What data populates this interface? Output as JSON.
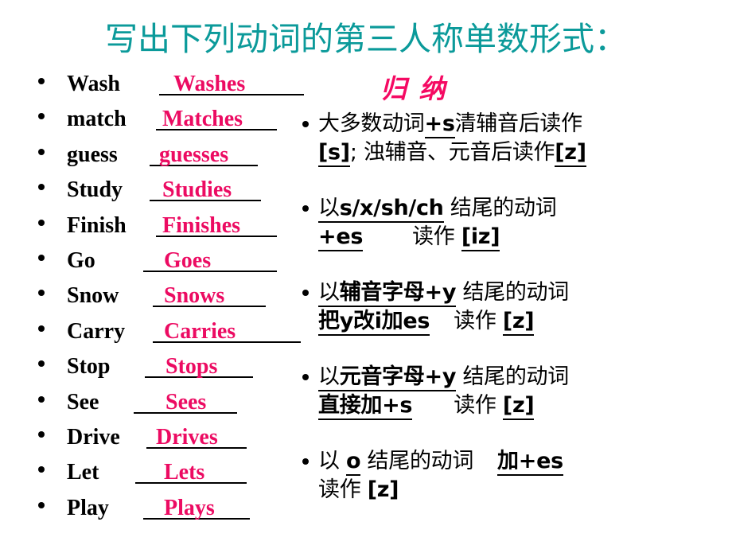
{
  "slide": {
    "title": "写出下列动词的第三人称单数形式：",
    "title_color": "#0b9a9a",
    "answer_color": "#ec0b62",
    "background": "#ffffff"
  },
  "left_column": {
    "rows": [
      {
        "verb": "Wash",
        "answer": "Washes"
      },
      {
        "verb": "match",
        "answer": "Matches"
      },
      {
        "verb": " guess",
        "answer": "guesses"
      },
      {
        "verb": "Study",
        "answer": "Studies"
      },
      {
        "verb": "Finish",
        "answer": "Finishes"
      },
      {
        "verb": "Go",
        "answer": "Goes"
      },
      {
        "verb": "Snow",
        "answer": "Snows"
      },
      {
        "verb": "Carry",
        "answer": "Carries"
      },
      {
        "verb": "Stop",
        "answer": "Stops"
      },
      {
        "verb": "See",
        "answer": "Sees"
      },
      {
        "verb": "Drive",
        "answer": "Drives"
      },
      {
        "verb": "Let",
        "answer": "Lets"
      },
      {
        "verb": "Play",
        "answer": "Plays"
      }
    ]
  },
  "right_column": {
    "heading": "归  纳",
    "heading_color": "#f50a63",
    "rules": [
      {
        "line1_a": "大多数动词",
        "line1_underlined": "+s",
        "line1_b": "清辅音后读作",
        "line2_a": "[s]",
        "line2_b": "; 浊辅音、元音后读作",
        "line2_c": "[z]",
        "full": "大多数动词+s 清辅音后读作[s]; 浊辅音、元音后读作[z]"
      },
      {
        "line1_a": "以",
        "line1_underlined": "s/x/sh/ch",
        "line1_b": "结尾的动词",
        "line2_underlined": "+es",
        "line2_b": "读作",
        "line2_c": "[iz]",
        "full": "以s/x/sh/ch 结尾的动词 +es  读作 [iz]"
      },
      {
        "line1_a": "以",
        "line1_underlined": "辅音字母+y",
        "line1_b": "结尾的动词",
        "line2_underlined": "把y改i加es",
        "line2_b": "读作",
        "line2_c": "[z]",
        "full": "以辅音字母+y 结尾的动词 把y改i加es  读作 [z]"
      },
      {
        "line1_a": "以",
        "line1_underlined": "元音字母+y",
        "line1_b": "结尾的动词",
        "line2_underlined": "直接加+s",
        "line2_b": "读作",
        "line2_c": "[z]",
        "full": "以元音字母+y 结尾的动词 直接加+s  读作 [z]"
      },
      {
        "line1_a": "以",
        "line1_underlined": "o",
        "line1_b": "结尾的动词",
        "line1_c": "加+es",
        "line2_b": "读作",
        "line2_c": "[z]",
        "full": "以 o 结尾的动词  加+es 读作 [z]"
      }
    ]
  }
}
